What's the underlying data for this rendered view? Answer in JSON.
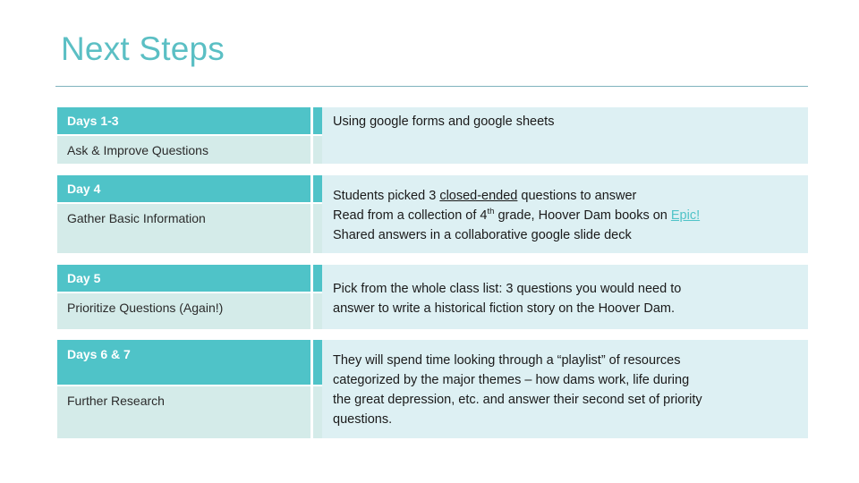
{
  "slide": {
    "title": "Next Steps"
  },
  "table": {
    "rows": [
      {
        "phase": "Days 1-3",
        "task": "Ask & Improve Questions",
        "detail_lines": [
          {
            "segments": [
              {
                "text": "Using google forms and google sheets",
                "style": "plain"
              }
            ]
          }
        ]
      },
      {
        "phase": "Day 4",
        "task": "Gather Basic Information",
        "detail_lines": [
          {
            "segments": [
              {
                "text": "Students picked 3 ",
                "style": "plain"
              },
              {
                "text": "closed-ended",
                "style": "underline"
              },
              {
                "text": " questions to answer",
                "style": "plain"
              }
            ]
          },
          {
            "segments": [
              {
                "text": "Read from a collection of 4",
                "style": "plain"
              },
              {
                "text": "th",
                "style": "superscript"
              },
              {
                "text": " grade, Hoover Dam books on ",
                "style": "plain"
              },
              {
                "text": "Epic!",
                "style": "link"
              }
            ]
          },
          {
            "segments": [
              {
                "text": "Shared answers in a collaborative google slide deck",
                "style": "plain"
              }
            ]
          }
        ]
      },
      {
        "phase": "Day 5",
        "task": "Prioritize Questions (Again!)",
        "detail_lines": [
          {
            "segments": [
              {
                "text": "Pick from the whole class list: 3 questions you would need to",
                "style": "plain"
              }
            ]
          },
          {
            "segments": [
              {
                "text": "answer to write a historical fiction story on the Hoover Dam.",
                "style": "plain"
              }
            ]
          }
        ]
      },
      {
        "phase": "Days 6 & 7",
        "task": "Further Research",
        "detail_lines": [
          {
            "segments": [
              {
                "text": "They will spend time looking through a “playlist” of resources",
                "style": "plain"
              }
            ]
          },
          {
            "segments": [
              {
                "text": "categorized by the major themes – how dams work, life during",
                "style": "plain"
              }
            ]
          },
          {
            "segments": [
              {
                "text": "the great depression, etc. and answer their second set of priority",
                "style": "plain"
              }
            ]
          },
          {
            "segments": [
              {
                "text": "questions.",
                "style": "plain"
              }
            ]
          }
        ]
      }
    ]
  },
  "colors": {
    "title": "#5BBFC4",
    "header_band": "#4FC3C8",
    "task_cell": "#D4EBE9",
    "detail_panel": "#DDF0F3",
    "rule": "#7FB3BD",
    "link": "#4FC3C8"
  }
}
